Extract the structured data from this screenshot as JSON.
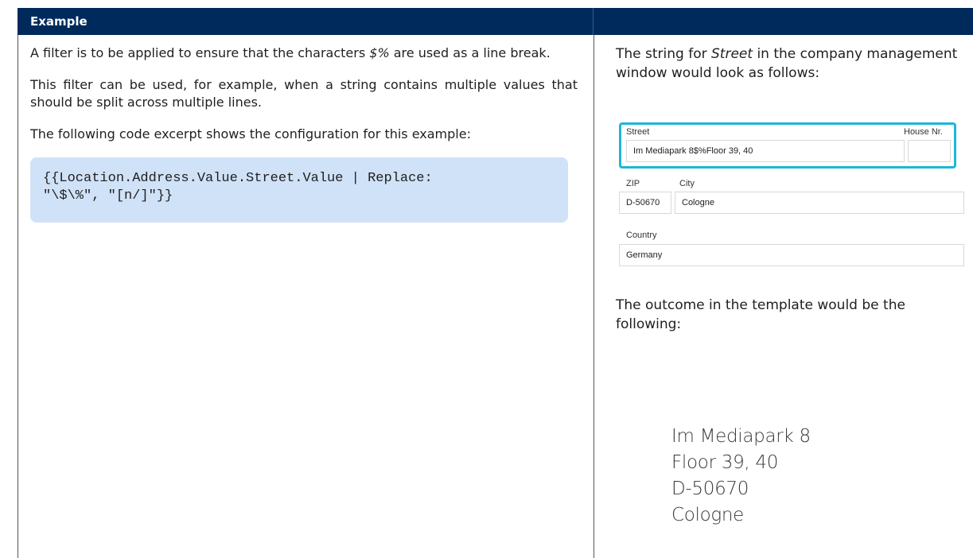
{
  "header": {
    "title": "Example"
  },
  "left": {
    "para1_a": "A filter is to be applied to ensure that the characters ",
    "para1_em": "$%",
    "para1_b": " are used as a line break.",
    "para2": "This filter can be used, for example, when a string contains multiple values that should be split across multiple lines.",
    "para3": "The following code excerpt shows the configuration for this example:",
    "code": "{{Location.Address.Value.Street.Value | Replace:\n\"\\$\\%\", \"[n/]\"}}"
  },
  "right": {
    "intro_a": "The string for ",
    "intro_em": "Street",
    "intro_b": " in the company management window would look as follows:",
    "form": {
      "street_label": "Street",
      "house_label": "House Nr.",
      "street_value": "Im Mediapark 8$%Floor 39, 40",
      "house_value": "",
      "zip_label": "ZIP",
      "city_label": "City",
      "zip_value": "D-50670",
      "city_value": "Cologne",
      "country_label": "Country",
      "country_value": "Germany"
    },
    "outcome_intro": "The outcome in the template would be the following:",
    "outcome_lines": [
      "Im Mediapark 8",
      "Floor 39, 40",
      "D-50670",
      "Cologne"
    ]
  }
}
